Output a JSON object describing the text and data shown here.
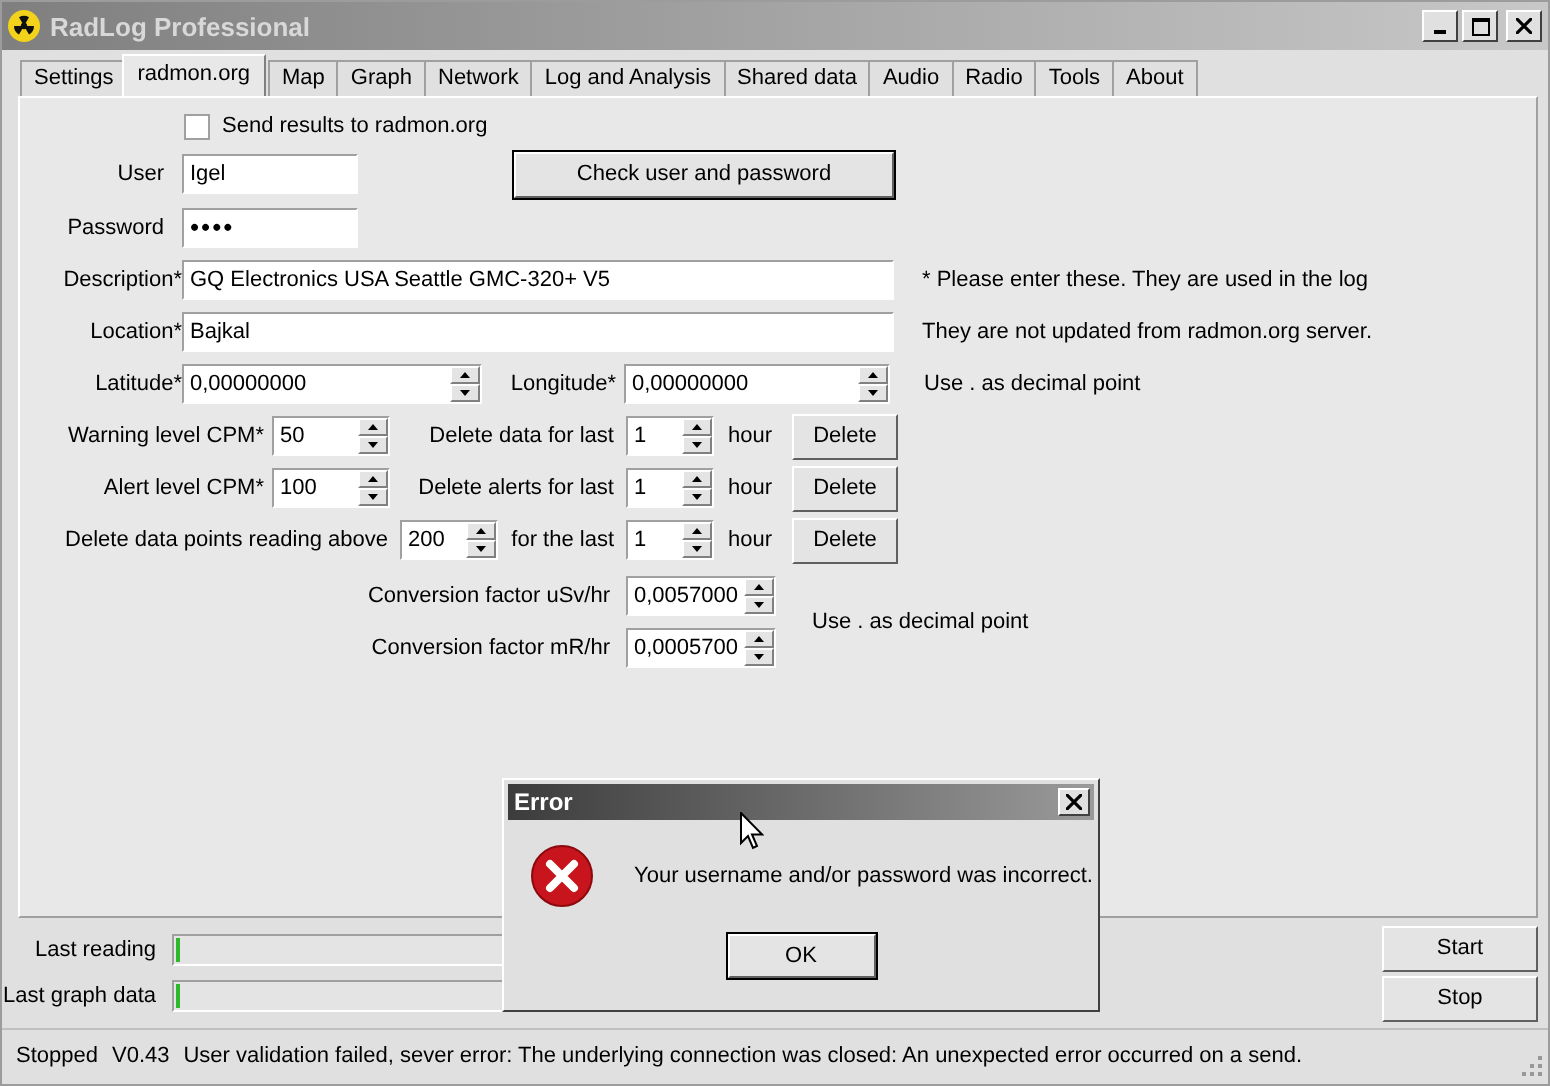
{
  "window": {
    "title": "RadLog Professional"
  },
  "tabs": [
    {
      "label": "Settings",
      "selected": false
    },
    {
      "label": "radmon.org",
      "selected": true
    },
    {
      "label": "Map",
      "selected": false
    },
    {
      "label": "Graph",
      "selected": false
    },
    {
      "label": "Network",
      "selected": false
    },
    {
      "label": "Log and Analysis",
      "selected": false
    },
    {
      "label": "Shared data",
      "selected": false
    },
    {
      "label": "Audio",
      "selected": false
    },
    {
      "label": "Radio",
      "selected": false
    },
    {
      "label": "Tools",
      "selected": false
    },
    {
      "label": "About",
      "selected": false
    }
  ],
  "radmon": {
    "send_results": {
      "label": "Send results to radmon.org",
      "checked": false
    },
    "user": {
      "label": "User",
      "value": "Igel"
    },
    "password": {
      "label": "Password",
      "value": "••••"
    },
    "check_button": "Check user and password",
    "description": {
      "label": "Description*",
      "value": "GQ Electronics USA Seattle GMC-320+ V5"
    },
    "location": {
      "label": "Location*",
      "value": "Bajkal"
    },
    "note_lines": [
      "* Please enter these. They are used in the log",
      "They are not updated from radmon.org server."
    ],
    "latitude": {
      "label": "Latitude*",
      "value": "0,00000000"
    },
    "longitude": {
      "label": "Longitude*",
      "value": "0,00000000"
    },
    "decimal_hint_1": "Use . as decimal point",
    "warning_level": {
      "label": "Warning level CPM*",
      "value": "50"
    },
    "alert_level": {
      "label": "Alert level CPM*",
      "value": "100"
    },
    "points_threshold": {
      "label": "Delete data points reading above",
      "value": "200"
    },
    "delete_rows": [
      {
        "label": "Delete data for last",
        "value": "1",
        "unit": "hour",
        "button": "Delete"
      },
      {
        "label": "Delete alerts for last",
        "value": "1",
        "unit": "hour",
        "button": "Delete"
      },
      {
        "label": "for the last",
        "value": "1",
        "unit": "hour",
        "button": "Delete"
      }
    ],
    "conversions": [
      {
        "label": "Conversion factor uSv/hr",
        "value": "0,0057000"
      },
      {
        "label": "Conversion factor mR/hr",
        "value": "0,0005700"
      }
    ],
    "decimal_hint_2": "Use . as decimal point"
  },
  "progress": [
    {
      "label": "Last reading",
      "level": 0.01
    },
    {
      "label": "Last graph data",
      "level": 0.01
    }
  ],
  "buttons": [
    "Start",
    "Stop"
  ],
  "status_bar": {
    "state": "Stopped",
    "version": "V0.43",
    "message": "User validation failed, sever error: The underlying connection was closed: An unexpected error occurred on a send."
  },
  "dialog": {
    "title": "Error",
    "message": "Your username and/or password was incorrect.",
    "button": "OK"
  }
}
